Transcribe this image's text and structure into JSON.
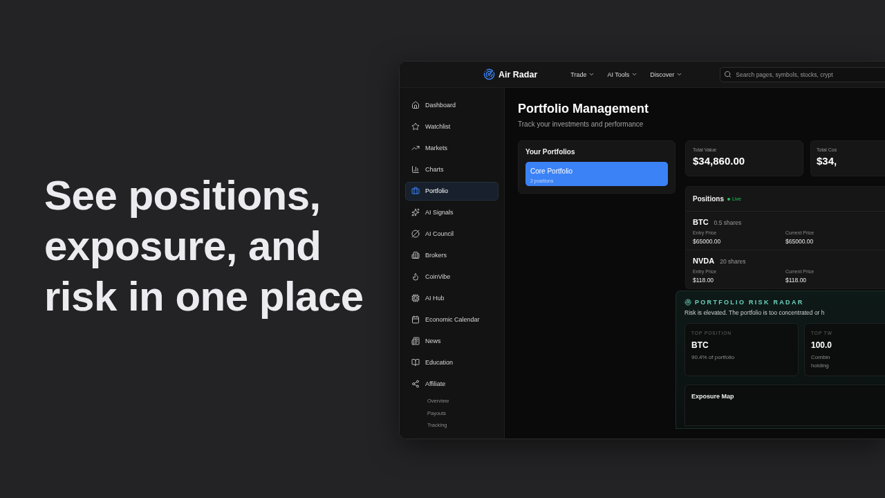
{
  "headline_lines": [
    "See positions,",
    "exposure, and",
    "risk in one place"
  ],
  "topbar": {
    "brand": "Air Radar",
    "nav": [
      {
        "label": "Trade"
      },
      {
        "label": "AI Tools"
      },
      {
        "label": "Discover"
      }
    ],
    "search": {
      "placeholder": "Search pages, symbols, stocks, crypt"
    }
  },
  "sidebar": {
    "items": [
      {
        "label": "Dashboard",
        "selected": false
      },
      {
        "label": "Watchlist",
        "selected": false
      },
      {
        "label": "Markets",
        "selected": false
      },
      {
        "label": "Charts",
        "selected": false
      },
      {
        "label": "Portfolio",
        "selected": true
      },
      {
        "label": "AI Signals",
        "selected": false
      },
      {
        "label": "AI Council",
        "selected": false
      },
      {
        "label": "Brokers",
        "selected": false
      },
      {
        "label": "CoinVibe",
        "selected": false
      },
      {
        "label": "AI Hub",
        "selected": false
      },
      {
        "label": "Economic Calendar",
        "selected": false
      },
      {
        "label": "News",
        "selected": false
      },
      {
        "label": "Education",
        "selected": false
      },
      {
        "label": "Affiliate",
        "selected": false,
        "children": [
          {
            "label": "Overview",
            "selected": false
          },
          {
            "label": "Payouts",
            "selected": false
          },
          {
            "label": "Tracking",
            "selected": false
          }
        ]
      }
    ]
  },
  "page": {
    "title": "Portfolio Management",
    "subtitle": "Track your investments and performance"
  },
  "portfolios": {
    "title": "Your Portfolios",
    "items": [
      {
        "name": "Core Portfolio",
        "count": "2 positions",
        "selected": true
      }
    ]
  },
  "stats": [
    {
      "label": "Total Value",
      "value": "$34,860.00"
    },
    {
      "label": "Total Cos",
      "value": "$34,"
    }
  ],
  "positions": {
    "title": "Positions",
    "status": {
      "label": "Live",
      "color": "#22c55e"
    },
    "rows": [
      {
        "symbol": "BTC",
        "shares": "0.5 shares",
        "entry_label": "Entry Price",
        "entry": "$65000.00",
        "current_label": "Current Price",
        "current": "$65000.00"
      },
      {
        "symbol": "NVDA",
        "shares": "20 shares",
        "entry_label": "Entry Price",
        "entry": "$118.00",
        "current_label": "Current Price",
        "current": "$118.00"
      }
    ]
  },
  "risk_radar": {
    "title": "PORTFOLIO RISK RADAR",
    "message": "Risk is elevated. The portfolio is too concentrated or h",
    "cards": [
      {
        "label": "TOP POSITION",
        "value": "BTC",
        "note": "90.4% of portfolio"
      },
      {
        "label": "TOP TW",
        "value": "100.0",
        "note": "Combin holding"
      }
    ],
    "exposure_title": "Exposure Map"
  }
}
